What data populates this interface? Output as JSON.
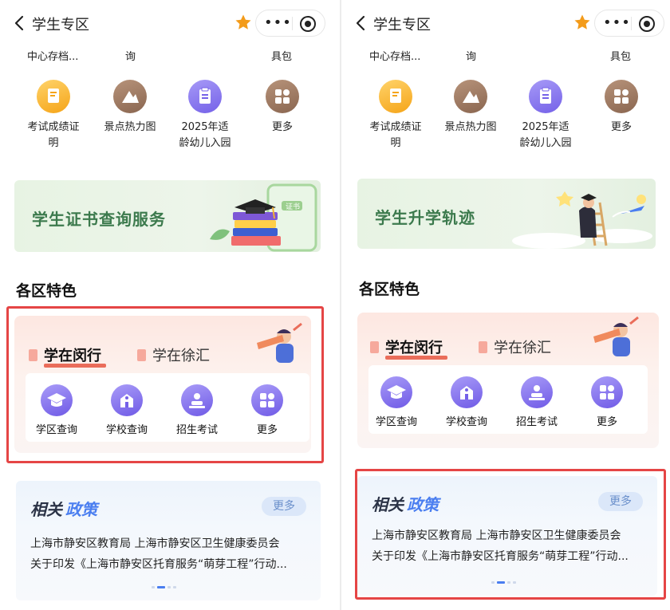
{
  "header": {
    "title": "学生专区",
    "more_label": "•••"
  },
  "service_row_truncated": [
    "中心存档...",
    "询",
    "具包"
  ],
  "service_icons": [
    {
      "label": "考试成绩证明",
      "line1": "考试成绩证",
      "line2": "明",
      "icon": "certificate-icon",
      "color": "#f5a418"
    },
    {
      "label": "景点热力图",
      "line1": "景点热力图",
      "line2": "",
      "icon": "mountain-icon",
      "color": "#8a6650"
    },
    {
      "label": "2025年适龄幼儿入园",
      "line1": "2025年适",
      "line2": "龄幼儿入园",
      "icon": "clipboard-icon",
      "color": "#7461e8"
    },
    {
      "label": "更多",
      "line1": "更多",
      "line2": "",
      "icon": "grid-more-icon",
      "color": "#8a6650"
    }
  ],
  "left_banner": {
    "title": "学生证书查询服务",
    "card_text": "证书"
  },
  "right_banner": {
    "title": "学生升学轨迹"
  },
  "districts": {
    "section_title": "各区特色",
    "tabs": [
      {
        "label": "学在闵行",
        "active": true
      },
      {
        "label": "学在徐汇",
        "active": false
      }
    ],
    "items": [
      {
        "label": "学区查询",
        "icon": "graduation-cap-icon"
      },
      {
        "label": "学校查询",
        "icon": "school-building-icon"
      },
      {
        "label": "招生考试",
        "icon": "exam-person-icon"
      },
      {
        "label": "更多",
        "icon": "grid-more-icon"
      }
    ]
  },
  "policy": {
    "title_part1": "相关",
    "title_part2": "政策",
    "more_label": "更多",
    "line1": "上海市静安区教育局 上海市静安区卫生健康委员会",
    "line2": "关于印发《上海市静安区托育服务“萌芽工程”行动..."
  },
  "colors": {
    "highlight": "#e54545",
    "accent_blue": "#4a7ef0",
    "star": "#f39b1a"
  }
}
